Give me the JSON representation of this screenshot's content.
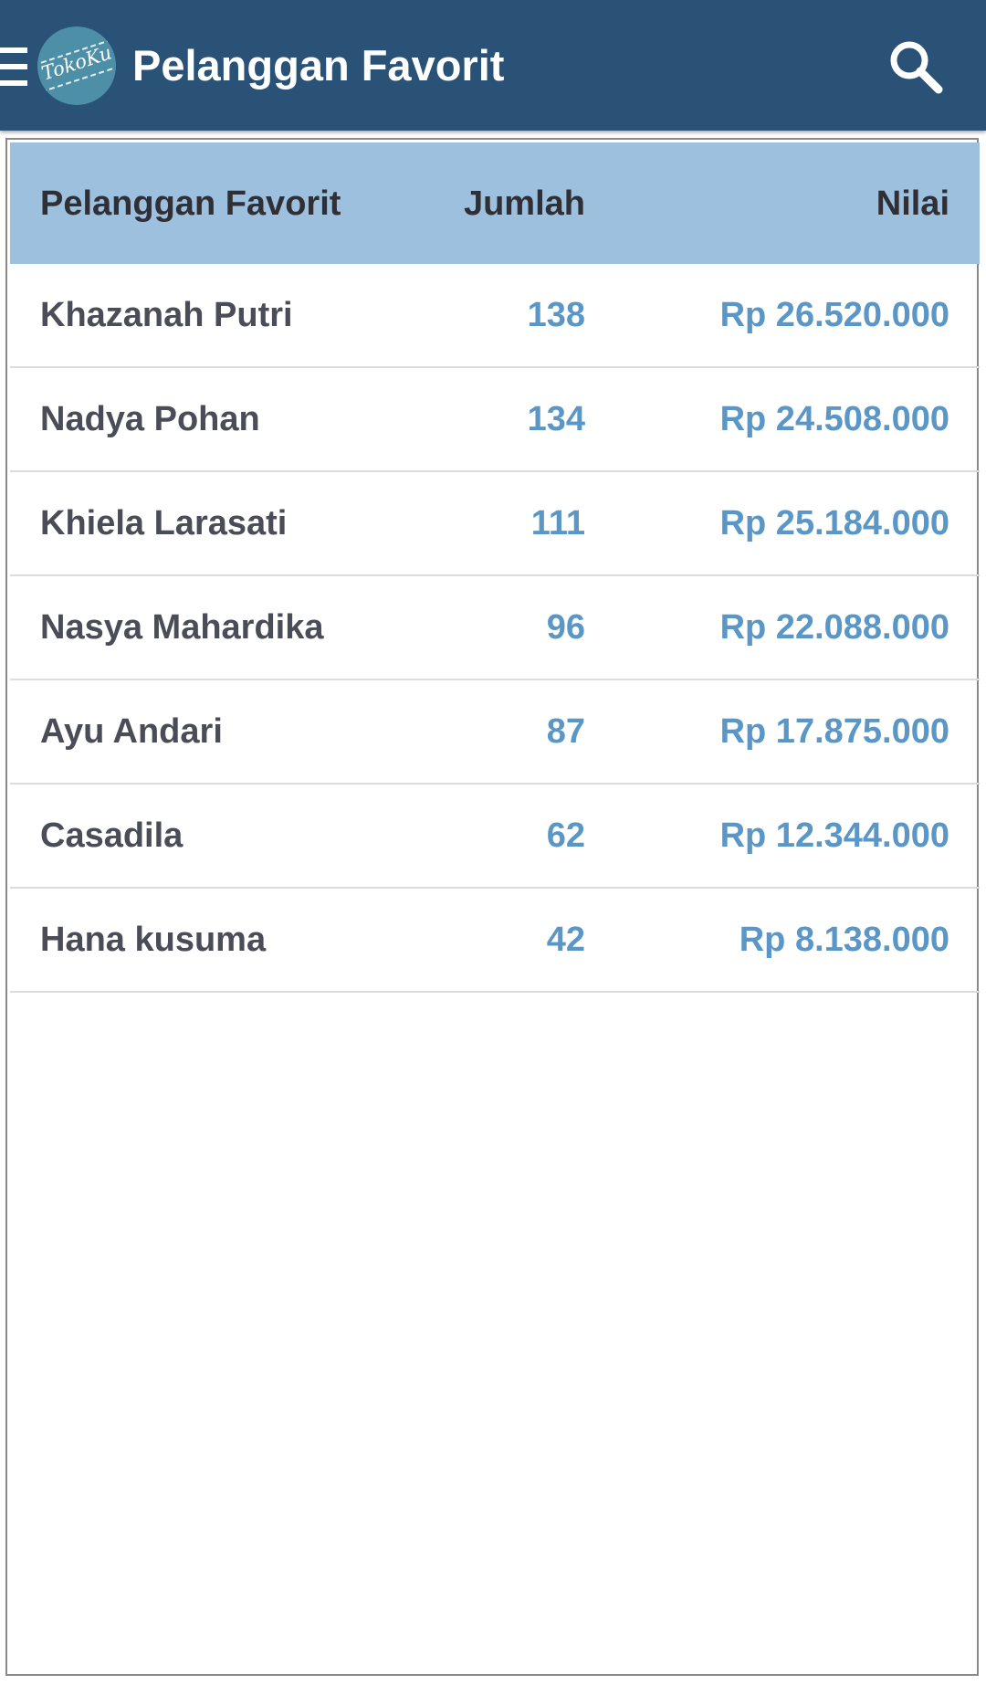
{
  "appbar": {
    "title": "Pelanggan Favorit",
    "logo_text": "TokoKu",
    "menu_icon": "hamburger-menu-icon",
    "search_icon": "search-icon",
    "bar_color": "#2a5277"
  },
  "table": {
    "header_color": "#9cc0dd",
    "value_color": "#5a97c6",
    "columns": {
      "name": "Pelanggan Favorit",
      "qty": "Jumlah",
      "value": "Nilai"
    },
    "rows": [
      {
        "name": "Khazanah Putri",
        "qty": "138",
        "value": "Rp 26.520.000"
      },
      {
        "name": "Nadya Pohan",
        "qty": "134",
        "value": "Rp 24.508.000"
      },
      {
        "name": "Khiela Larasati",
        "qty": "111",
        "value": "Rp 25.184.000"
      },
      {
        "name": "Nasya Mahardika",
        "qty": "96",
        "value": "Rp 22.088.000"
      },
      {
        "name": "Ayu Andari",
        "qty": "87",
        "value": "Rp 17.875.000"
      },
      {
        "name": "Casadila",
        "qty": "62",
        "value": "Rp 12.344.000"
      },
      {
        "name": "Hana kusuma",
        "qty": "42",
        "value": "Rp 8.138.000"
      }
    ]
  }
}
